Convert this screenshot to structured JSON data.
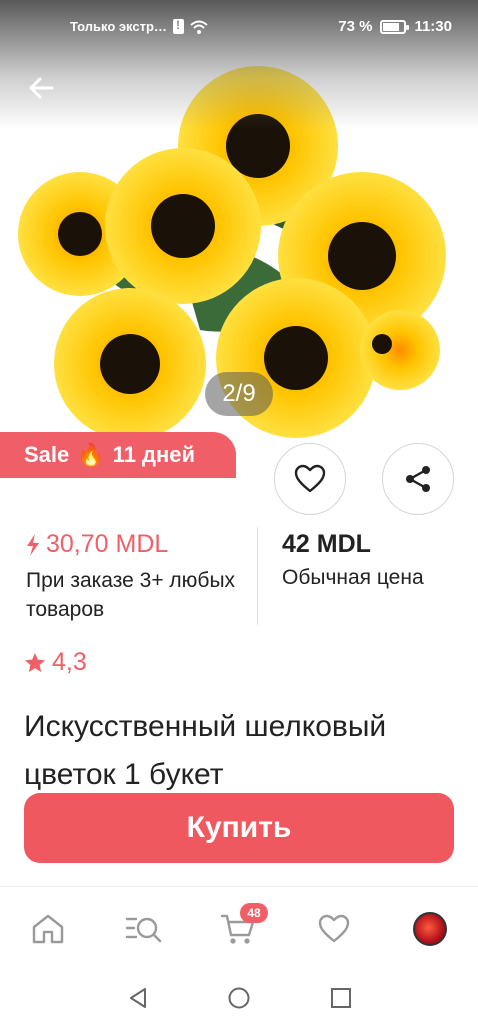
{
  "status_bar": {
    "notification_text": "Только экстр…",
    "battery": "73 %",
    "time": "11:30"
  },
  "gallery": {
    "counter": "2/9"
  },
  "sale_badge": {
    "label": "Sale",
    "emoji": "🔥",
    "duration": "11 дней"
  },
  "price": {
    "sale_price": "30,70 MDL",
    "sale_note": "При заказе 3+ любых товаров",
    "regular_price": "42 MDL",
    "regular_note": "Обычная цена"
  },
  "rating": {
    "value": "4,3"
  },
  "product": {
    "title": "Искусственный шелковый цветок 1 букет"
  },
  "actions": {
    "buy_label": "Купить"
  },
  "bottom_nav": {
    "cart_count": "48",
    "items": [
      "home-icon",
      "catalog-search-icon",
      "cart-icon",
      "favorites-icon",
      "profile-avatar"
    ]
  },
  "colors": {
    "accent": "#f05f67",
    "buy_button": "#f0585f",
    "text": "#222222"
  }
}
